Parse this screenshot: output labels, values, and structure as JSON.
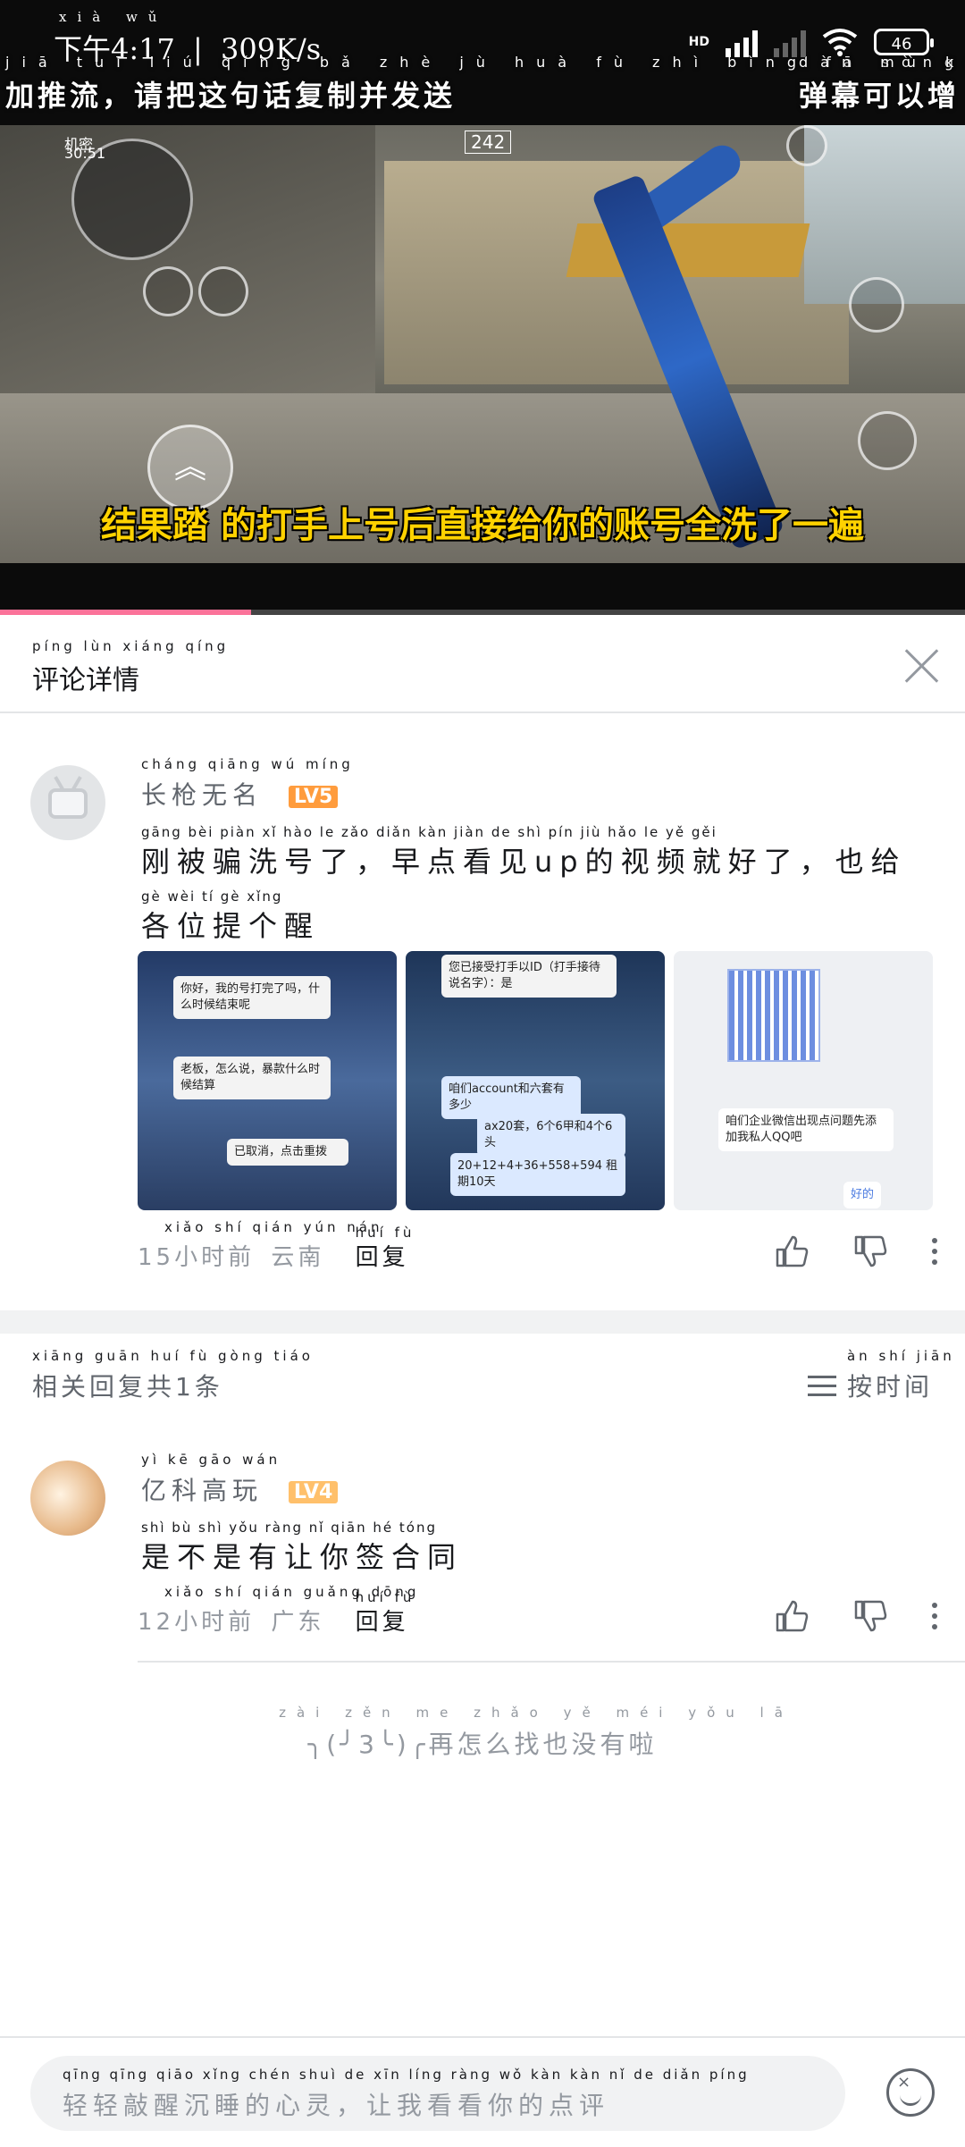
{
  "status_bar": {
    "time": "下午4:17",
    "time_ruby": "xià wǔ",
    "speed": "309K/s",
    "network": "HD",
    "battery": "46"
  },
  "video": {
    "danmaku_left": "加推流，请把这句话复制并发送",
    "danmaku_left_ruby": "jiā tuī liú qǐng bǎ zhè jù huà fù zhì bìng fā sòng",
    "danmaku_right": "弹幕可以增",
    "danmaku_right_ruby": "dàn mù kě yǐ zēng",
    "hud_counter": "242",
    "hud_map_label": "机密",
    "hud_timer": "30:51",
    "subtitle": "结果踏 的打手上号后直接给你的账号全洗了一遍",
    "progress": 0.26
  },
  "comment_detail": {
    "title": "评论详情",
    "title_ruby": "píng lùn xiáng qíng"
  },
  "main_comment": {
    "username": "长枪无名",
    "username_ruby": "cháng qiāng wú míng",
    "level": "LV5",
    "content_line1": "刚被骗洗号了，早点看见up的视频就好了，也给",
    "content_line1_ruby": "gāng bèi piàn xǐ hào le      zǎo diǎn kàn jiàn    de shì pín jiù hǎo le      yě gěi",
    "content_line2": "各位提个醒",
    "content_line2_ruby": "gè wèi tí gè xǐng",
    "images": [
      {
        "lines": [
          "你好，我的号打完了吗，什么时候结束呢",
          "老板，怎么说，暴款什么时候结算",
          "已取消，点击重拨"
        ]
      },
      {
        "lines": [
          "您已接受打手以ID（打手接待说名字）：是",
          "咱们account和六套有多少",
          "ax20套，6个6甲和4个6头",
          "20+12+4+36+558+594 租期10天"
        ]
      },
      {
        "lines": [
          "咱们企业微信出现点问题先添加我私人QQ吧",
          "好的"
        ]
      }
    ],
    "time": "15小时前",
    "location": "云南",
    "time_ruby": "xiǎo shí qián yún nán",
    "reply_label": "回复",
    "reply_ruby": "huí fù"
  },
  "related": {
    "title": "相关回复共1条",
    "title_ruby": "xiāng guān huí fù gòng tiáo",
    "sort_label": "按时间",
    "sort_ruby": "àn shí jiān"
  },
  "reply_comment": {
    "username": "亿科高玩",
    "username_ruby": "yì kē gāo wán",
    "level": "LV4",
    "content": "是不是有让你签合同",
    "content_ruby": "shì bù shì yǒu ràng nǐ qiān hé tóng",
    "time": "12小时前",
    "location": "广东",
    "time_ruby": "xiǎo shí qián guǎng dōng",
    "reply_label": "回复",
    "reply_ruby": "huí fù"
  },
  "end_note": {
    "text": "╮(╯3╰)╭再怎么找也没有啦",
    "ruby": "zài zěn me zhǎo yě méi yǒu lā"
  },
  "input": {
    "placeholder": "轻轻敲醒沉睡的心灵，让我看看你的点评",
    "placeholder_ruby": "qīng qīng qiāo xǐng chén shuì de xīn líng   ràng wǒ kàn kàn nǐ de diǎn píng"
  },
  "colors": {
    "accent_pink": "#fb7299",
    "level5": "#ff9c3d",
    "level4": "#ffc06b",
    "subtitle_yellow": "#ffd200"
  },
  "icons": [
    "like-icon",
    "dislike-icon",
    "more-icon",
    "close-icon",
    "sort-icon",
    "emoji-icon",
    "wifi-icon",
    "signal-icon",
    "battery-icon"
  ]
}
